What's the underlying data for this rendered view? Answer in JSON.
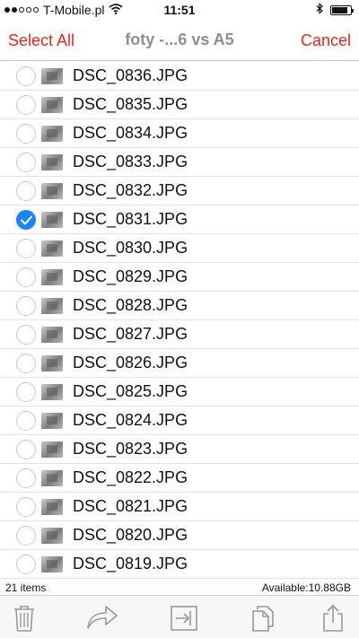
{
  "status_bar": {
    "carrier": "T-Mobile.pl",
    "time": "11:51",
    "signal_bars": 2,
    "signal_total": 5,
    "battery_level": 0.85,
    "icons": [
      "signal-dots-icon",
      "wifi-icon",
      "bluetooth-icon",
      "battery-icon"
    ]
  },
  "nav": {
    "left_button": "Select All",
    "title": "foty -...6 vs A5",
    "right_button": "Cancel"
  },
  "colors": {
    "accent": "#e8231c",
    "checkbox_selected": "#1b84f7",
    "title": "#8e8e93"
  },
  "files": [
    {
      "name": "DSC_0836.JPG",
      "selected": false
    },
    {
      "name": "DSC_0835.JPG",
      "selected": false
    },
    {
      "name": "DSC_0834.JPG",
      "selected": false
    },
    {
      "name": "DSC_0833.JPG",
      "selected": false
    },
    {
      "name": "DSC_0832.JPG",
      "selected": false
    },
    {
      "name": "DSC_0831.JPG",
      "selected": true
    },
    {
      "name": "DSC_0830.JPG",
      "selected": false
    },
    {
      "name": "DSC_0829.JPG",
      "selected": false
    },
    {
      "name": "DSC_0828.JPG",
      "selected": false
    },
    {
      "name": "DSC_0827.JPG",
      "selected": false
    },
    {
      "name": "DSC_0826.JPG",
      "selected": false
    },
    {
      "name": "DSC_0825.JPG",
      "selected": false
    },
    {
      "name": "DSC_0824.JPG",
      "selected": false
    },
    {
      "name": "DSC_0823.JPG",
      "selected": false
    },
    {
      "name": "DSC_0822.JPG",
      "selected": false
    },
    {
      "name": "DSC_0821.JPG",
      "selected": false
    },
    {
      "name": "DSC_0820.JPG",
      "selected": false
    },
    {
      "name": "DSC_0819.JPG",
      "selected": false
    }
  ],
  "info": {
    "items_count": "21 items",
    "available": "Available:10.88GB"
  },
  "toolbar": {
    "icons": [
      "trash-icon",
      "share-forward-icon",
      "move-into-icon",
      "copy-icon",
      "upload-icon"
    ]
  }
}
